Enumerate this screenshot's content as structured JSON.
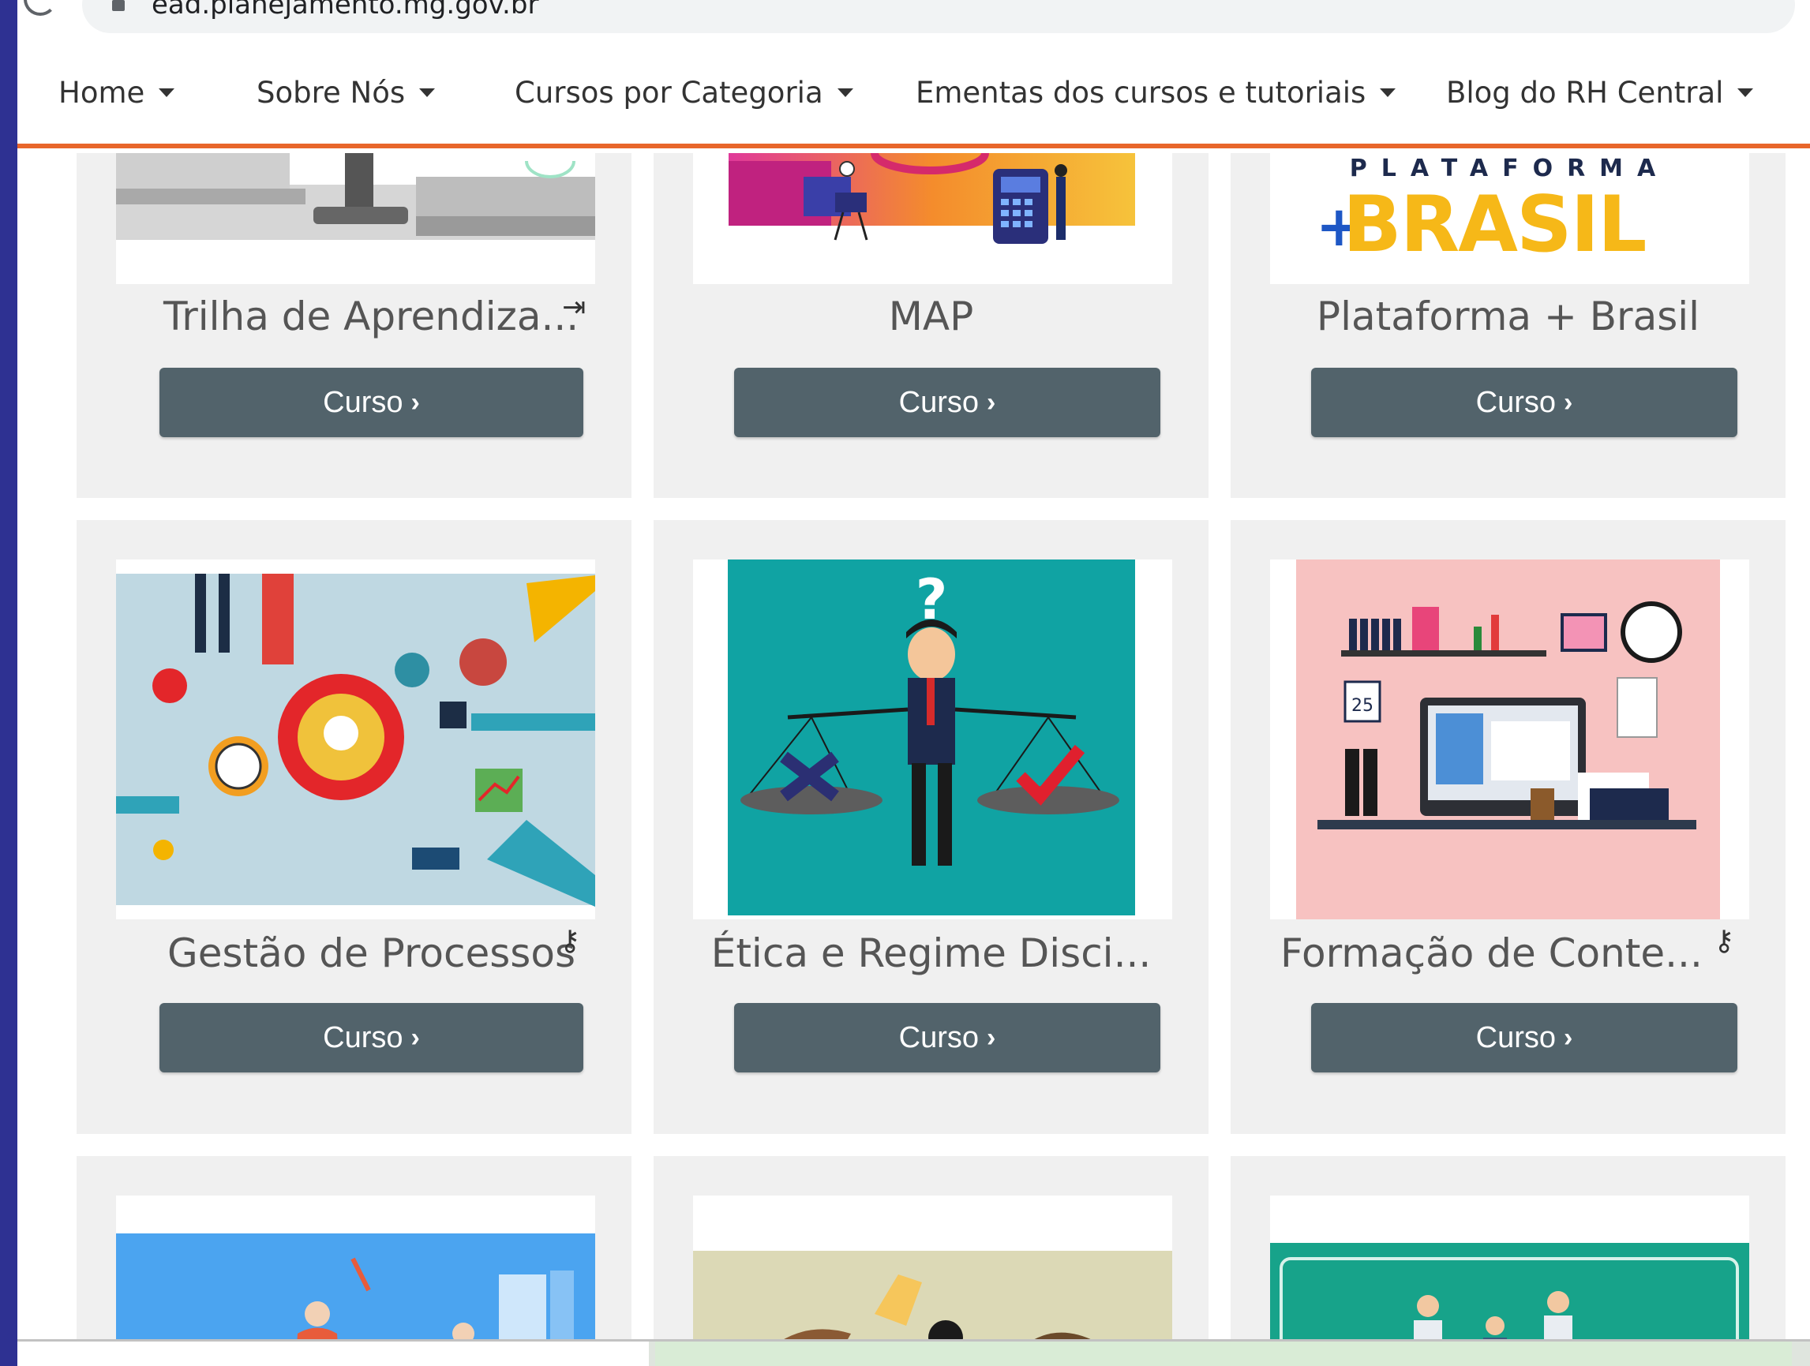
{
  "browser": {
    "url": "ead.planejamento.mg.gov.br"
  },
  "nav": {
    "items": [
      {
        "label": "Home"
      },
      {
        "label": "Sobre Nós"
      },
      {
        "label": "Cursos por Categoria"
      },
      {
        "label": "Ementas dos cursos e tutoriais"
      },
      {
        "label": "Blog do RH Central"
      }
    ]
  },
  "logo_plataforma": {
    "top_text": "PLATAFORMA",
    "main_text": "BRASIL",
    "plus": "+"
  },
  "courses": [
    {
      "title": "Trilha de Aprendiza...",
      "icon": "sign-in-icon",
      "icon_glyph": "⇥",
      "button_label": "Curso"
    },
    {
      "title": "MAP",
      "icon": "",
      "icon_glyph": "",
      "button_label": "Curso"
    },
    {
      "title": "Plataforma + Brasil",
      "icon": "",
      "icon_glyph": "",
      "button_label": "Curso"
    },
    {
      "title": "Gestão de Processos",
      "icon": "key-icon",
      "icon_glyph": "⚷",
      "button_label": "Curso"
    },
    {
      "title": "Ética e Regime Disci...",
      "icon": "",
      "icon_glyph": "",
      "button_label": "Curso"
    },
    {
      "title": "Formação de Conte...",
      "icon": "key-icon",
      "icon_glyph": "⚷",
      "button_label": "Curso"
    }
  ],
  "illustrations": {
    "calendar_day": "25",
    "question_mark": "?"
  },
  "colors": {
    "frame": "#2e3192",
    "nav_accent": "#e8662b",
    "button": "#52636b",
    "card_bg": "#f0f0f0",
    "teal": "#10a3a3",
    "pink": "#f7c2c1"
  }
}
